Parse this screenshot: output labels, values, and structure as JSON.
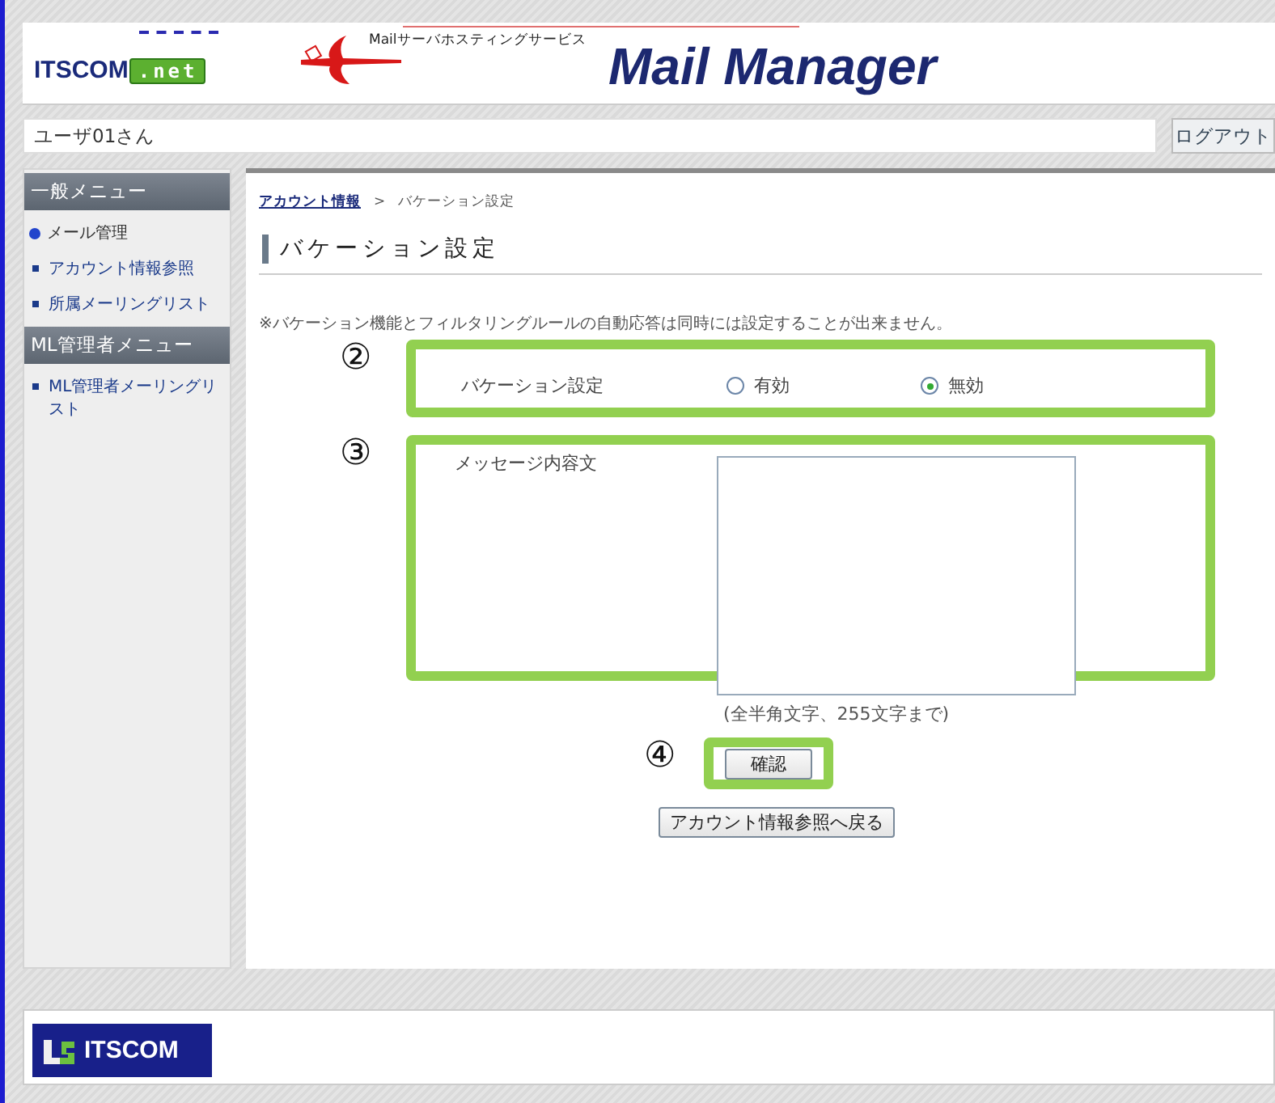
{
  "header": {
    "logo": "ITSCOM",
    "logo_badge": ".net",
    "service_label": "Mailサーバホスティングサービス",
    "title": "Mail Manager"
  },
  "user_bar": {
    "user": "ユーザ01さん",
    "logout": "ログアウト"
  },
  "sidebar": [
    {
      "title": "一般メニュー",
      "items": [
        {
          "label": "メール管理",
          "kind": "current"
        },
        {
          "label": "アカウント情報参照",
          "kind": "link"
        },
        {
          "label": "所属メーリングリスト",
          "kind": "link"
        }
      ]
    },
    {
      "title": "ML管理者メニュー",
      "items": [
        {
          "label": "ML管理者メーリングリスト",
          "kind": "link"
        }
      ]
    }
  ],
  "breadcrumb": [
    {
      "label": "アカウント情報",
      "kind": "link"
    },
    {
      "label": ">",
      "kind": "sep"
    },
    {
      "label": "バケーション設定",
      "kind": "text"
    }
  ],
  "page_title": "バケーション設定",
  "notice": "※バケーション機能とフィルタリングルールの自動応答は同時には設定することが出来ません。",
  "vacation": {
    "marker": "②",
    "label": "バケーション設定",
    "options": [
      {
        "label": "有効",
        "selected": false
      },
      {
        "label": "無効",
        "selected": true
      }
    ]
  },
  "message": {
    "marker": "③",
    "label": "メッセージ内容文",
    "hint": "(全半角文字、255文字まで)"
  },
  "confirm": {
    "marker": "④",
    "label": "確認"
  },
  "back_button": "アカウント情報参照へ戻る",
  "footer": {
    "logo": "ITSCOM"
  }
}
